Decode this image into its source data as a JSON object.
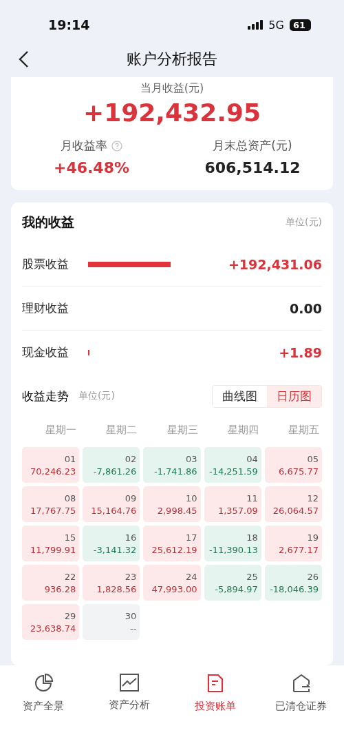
{
  "status_bar": {
    "time": "19:14",
    "network": "5G",
    "battery": "61"
  },
  "nav": {
    "title": "账户分析报告"
  },
  "summary": {
    "label": "当月收益(元)",
    "value": "+192,432.95",
    "stats": [
      {
        "label": "月收益率",
        "value": "+46.48%",
        "help": true,
        "kind": "gain"
      },
      {
        "label": "月末总资产(元)",
        "value": "606,514.12",
        "help": false,
        "kind": "plain"
      }
    ]
  },
  "income": {
    "title": "我的收益",
    "unit": "单位(元)",
    "rows": [
      {
        "label": "股票收益",
        "value": "+192,431.06",
        "kind": "gain-bar"
      },
      {
        "label": "理财收益",
        "value": "0.00",
        "kind": "plain"
      },
      {
        "label": "现金收益",
        "value": "+1.89",
        "kind": "gain-tick"
      }
    ]
  },
  "trend": {
    "title": "收益走势",
    "unit": "单位(元)",
    "tabs": [
      {
        "label": "曲线图",
        "selected": false
      },
      {
        "label": "日历图",
        "selected": true
      }
    ],
    "weekdays": [
      "星期一",
      "星期二",
      "星期三",
      "星期四",
      "星期五"
    ],
    "days": [
      {
        "day": "01",
        "value": "70,246.23",
        "kind": "gain"
      },
      {
        "day": "02",
        "value": "-7,861.26",
        "kind": "loss"
      },
      {
        "day": "03",
        "value": "-1,741.86",
        "kind": "loss"
      },
      {
        "day": "04",
        "value": "-14,251.59",
        "kind": "loss"
      },
      {
        "day": "05",
        "value": "6,675.77",
        "kind": "gain"
      },
      {
        "day": "08",
        "value": "17,767.75",
        "kind": "gain"
      },
      {
        "day": "09",
        "value": "15,164.76",
        "kind": "gain"
      },
      {
        "day": "10",
        "value": "2,998.45",
        "kind": "gain"
      },
      {
        "day": "11",
        "value": "1,357.09",
        "kind": "gain"
      },
      {
        "day": "12",
        "value": "26,064.57",
        "kind": "gain"
      },
      {
        "day": "15",
        "value": "11,799.91",
        "kind": "gain"
      },
      {
        "day": "16",
        "value": "-3,141.32",
        "kind": "loss"
      },
      {
        "day": "17",
        "value": "25,612.19",
        "kind": "gain"
      },
      {
        "day": "18",
        "value": "-11,390.13",
        "kind": "loss"
      },
      {
        "day": "19",
        "value": "2,677.17",
        "kind": "gain"
      },
      {
        "day": "22",
        "value": "936.28",
        "kind": "gain"
      },
      {
        "day": "23",
        "value": "1,828.56",
        "kind": "gain"
      },
      {
        "day": "24",
        "value": "47,993.00",
        "kind": "gain"
      },
      {
        "day": "25",
        "value": "-5,894.97",
        "kind": "loss"
      },
      {
        "day": "26",
        "value": "-18,046.39",
        "kind": "loss"
      },
      {
        "day": "29",
        "value": "23,638.74",
        "kind": "gain"
      },
      {
        "day": "30",
        "value": "--",
        "kind": "none"
      }
    ]
  },
  "tab_bar": [
    {
      "label": "资产全景",
      "selected": false
    },
    {
      "label": "资产分析",
      "selected": false
    },
    {
      "label": "投资账单",
      "selected": true
    },
    {
      "label": "已清仓证券",
      "selected": false
    }
  ]
}
